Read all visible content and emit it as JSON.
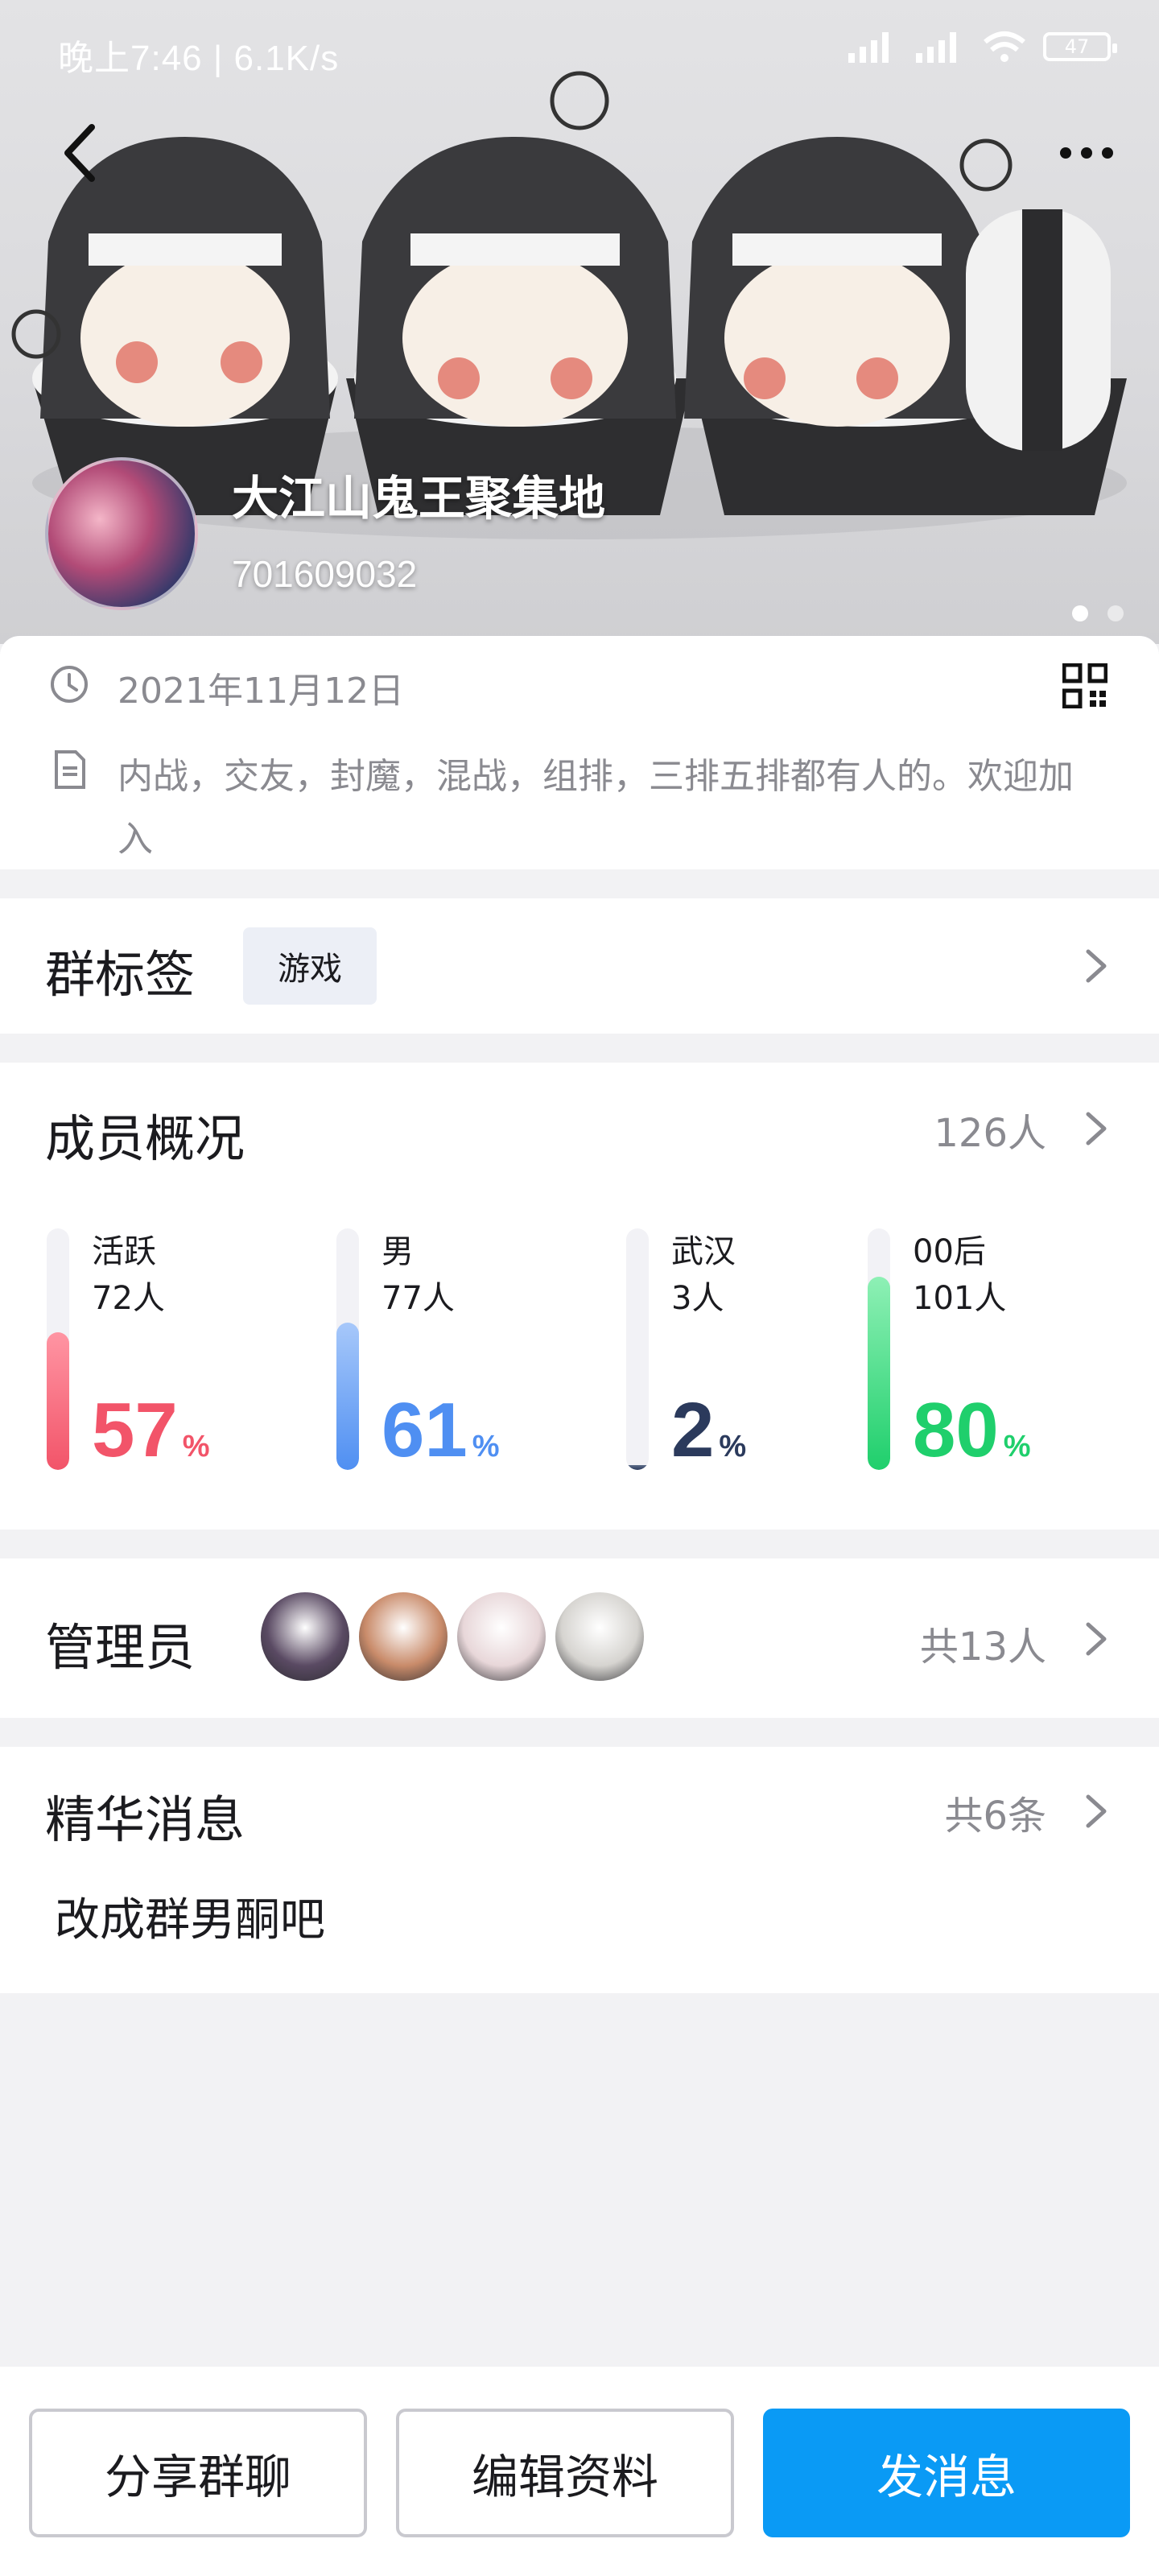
{
  "status_bar": {
    "time_speed": "晚上7:46 | 6.1K/s",
    "battery": "47"
  },
  "header": {
    "group_name": "大江山鬼王聚集地",
    "group_id": "701609032",
    "slide_count": 2
  },
  "info": {
    "date": "2021年11月12日",
    "description": "内战，交友，封魔，混战，组排，三排五排都有人的。欢迎加入"
  },
  "tags": {
    "title": "群标签",
    "items": [
      "游戏"
    ]
  },
  "members": {
    "title": "成员概况",
    "count": "126人",
    "stats": [
      {
        "label": "活跃",
        "count": "72人",
        "percent": "57",
        "unit": "%",
        "fraction": 0.57,
        "color": "#f25469",
        "color_light": "#ff95a3"
      },
      {
        "label": "男",
        "count": "77人",
        "percent": "61",
        "unit": "%",
        "fraction": 0.61,
        "color": "#4f8ff2",
        "color_light": "#a7c8fa"
      },
      {
        "label": "武汉",
        "count": "3人",
        "percent": "2",
        "unit": "%",
        "fraction": 0.02,
        "color": "#2b3a5c",
        "color_light": "#5f6e8a"
      },
      {
        "label": "00后",
        "count": "101人",
        "percent": "80",
        "unit": "%",
        "fraction": 0.8,
        "color": "#1fcf6c",
        "color_light": "#8ef0b5"
      }
    ]
  },
  "admins": {
    "title": "管理员",
    "count": "共13人",
    "avatar_colors": [
      "#5a4a63",
      "#c98b6a",
      "#e8d7d9",
      "#d6d4d0"
    ]
  },
  "essence": {
    "title": "精华消息",
    "count": "共6条",
    "preview": "改成群男酮吧"
  },
  "actions": {
    "share": "分享群聊",
    "edit": "编辑资料",
    "send": "发消息"
  }
}
